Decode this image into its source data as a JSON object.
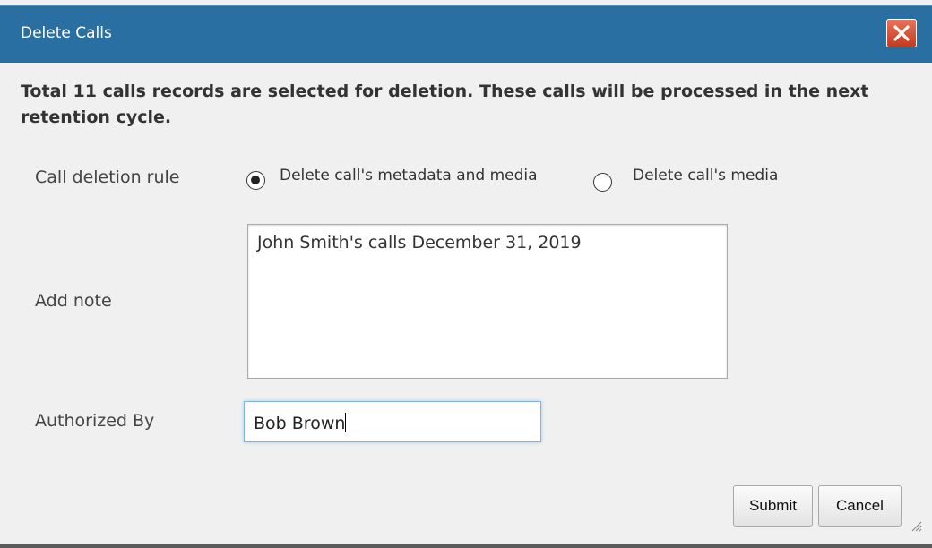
{
  "dialog": {
    "title": "Delete Calls",
    "close_icon": "close-x-icon",
    "message": "Total 11 calls records are selected for deletion. These calls will be processed in the next retention cycle."
  },
  "form": {
    "deletion_rule": {
      "label": "Call deletion rule",
      "options": [
        {
          "label": "Delete call's metadata and media",
          "selected": true
        },
        {
          "label": "Delete call's media",
          "selected": false
        }
      ]
    },
    "note": {
      "label": "Add note",
      "value": "John Smith's calls December 31, 2019"
    },
    "authorized_by": {
      "label": "Authorized By",
      "value": "Bob Brown"
    }
  },
  "actions": {
    "submit_label": "Submit",
    "cancel_label": "Cancel"
  },
  "colors": {
    "titlebar": "#2a6fa1",
    "close_button": "#d9532f",
    "dialog_background": "#f0f0f0"
  }
}
